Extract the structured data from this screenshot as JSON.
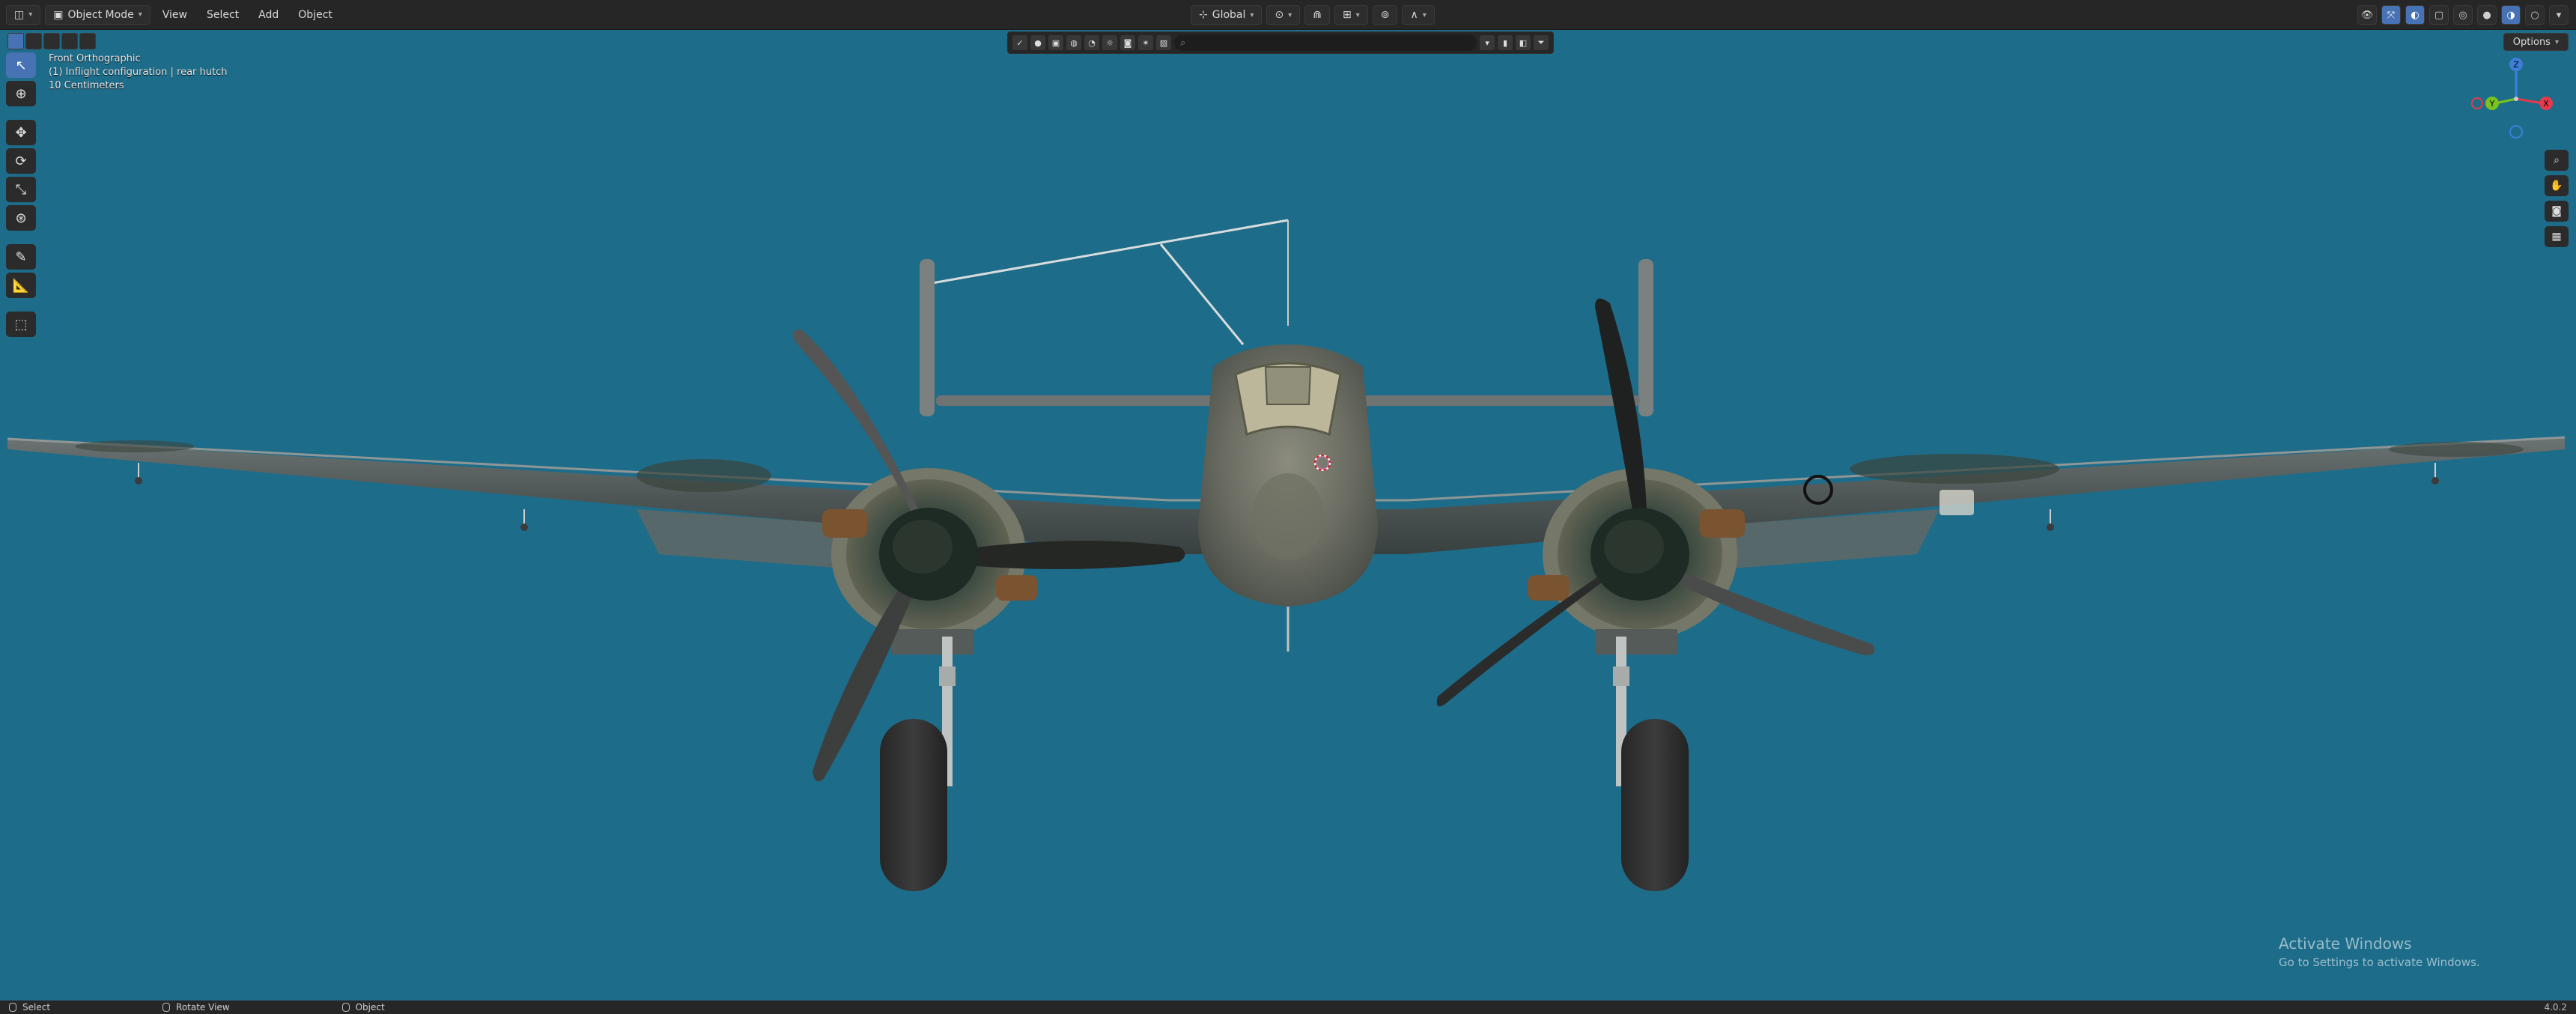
{
  "header": {
    "mode_label": "Object Mode",
    "menus": [
      "View",
      "Select",
      "Add",
      "Object"
    ]
  },
  "viewport_header": {
    "transform_orientation": "Global",
    "search_placeholder": "",
    "options_label": "Options"
  },
  "overlay": {
    "view_name": "Front Orthographic",
    "collection_info": "(1) Inflight configuration | rear hutch",
    "scale_info": "10 Centimeters"
  },
  "gizmo": {
    "z_label": "Z",
    "y_label": "Y",
    "x_label": "X",
    "colors": {
      "x": "#e33a4c",
      "y": "#7ac31f",
      "z": "#3d7fd6"
    }
  },
  "watermark": {
    "title": "Activate Windows",
    "subtitle": "Go to Settings to activate Windows."
  },
  "statusbar": {
    "select_label": "Select",
    "rotate_label": "Rotate View",
    "object_label": "Object",
    "version": "4.0.2"
  },
  "colors": {
    "viewport_bg": "#1d6c8a",
    "accent": "#4772b3"
  }
}
